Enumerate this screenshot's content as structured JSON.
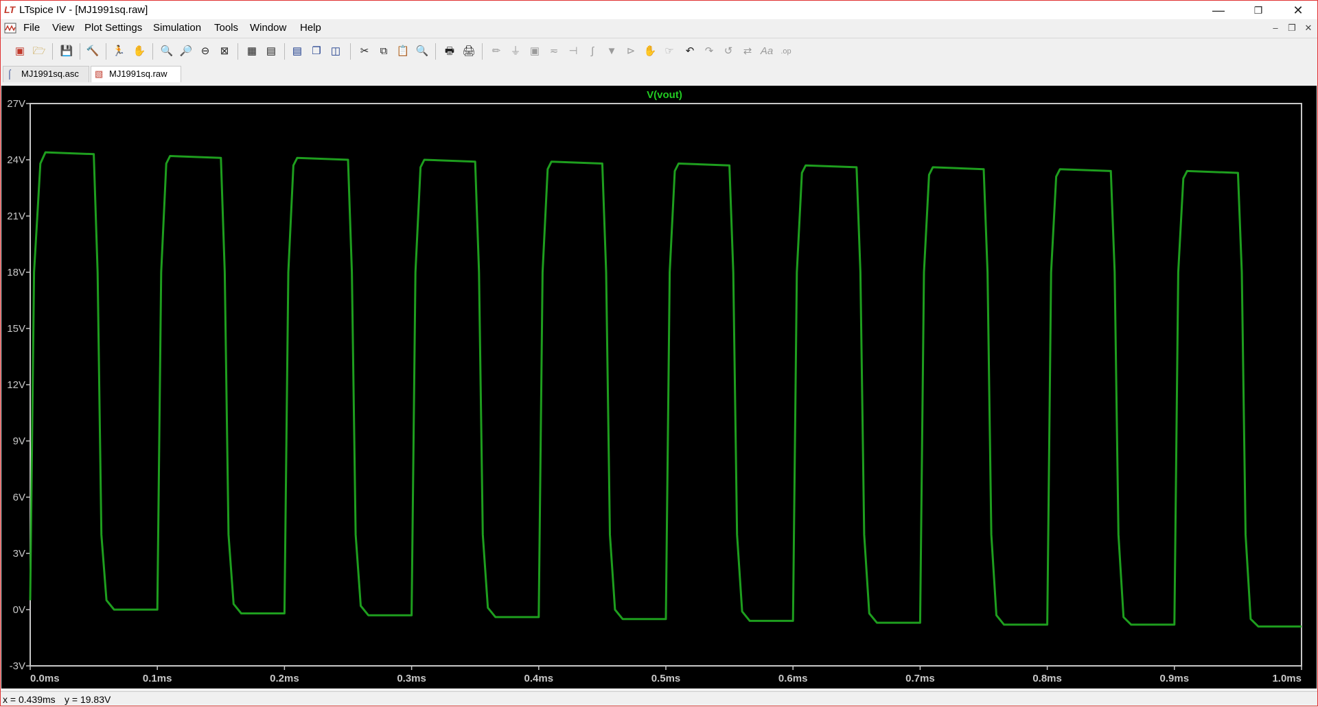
{
  "window": {
    "title": "LTspice IV - [MJ1991sq.raw]",
    "logo": "LT",
    "controls": [
      "minimize-icon",
      "restore-icon",
      "close-icon"
    ]
  },
  "menu": {
    "items": [
      "File",
      "View",
      "Plot Settings",
      "Simulation",
      "Tools",
      "Window",
      "Help"
    ]
  },
  "tabs": [
    {
      "label": "MJ1991sq.asc",
      "icon": "schematic-icon",
      "active": false
    },
    {
      "label": "MJ1991sq.raw",
      "icon": "waveform-icon",
      "active": true
    }
  ],
  "status": {
    "x_readout": "x = 0.439ms",
    "y_readout": "y = 19.83V"
  },
  "colors": {
    "trace": "#1e9e1e",
    "background": "#000000",
    "frame": "#c8c8c8",
    "title": "#22cc22"
  },
  "chart_data": {
    "type": "line",
    "title": "V(vout)",
    "xlabel": "",
    "ylabel": "",
    "xlim": [
      0,
      1.0
    ],
    "ylim": [
      -3,
      27
    ],
    "x_ticks": [
      "0.0ms",
      "0.1ms",
      "0.2ms",
      "0.3ms",
      "0.4ms",
      "0.5ms",
      "0.6ms",
      "0.7ms",
      "0.8ms",
      "0.9ms",
      "1.0ms"
    ],
    "y_ticks": [
      "27V",
      "24V",
      "21V",
      "18V",
      "15V",
      "12V",
      "9V",
      "6V",
      "3V",
      "0V",
      "-3V"
    ],
    "x_tick_values": [
      0,
      0.1,
      0.2,
      0.3,
      0.4,
      0.5,
      0.6,
      0.7,
      0.8,
      0.9,
      1.0
    ],
    "y_tick_values": [
      27,
      24,
      21,
      18,
      15,
      12,
      9,
      6,
      3,
      0,
      -3
    ],
    "grid": false,
    "series": [
      {
        "name": "V(vout)",
        "x": [
          0.0,
          0.003,
          0.008,
          0.012,
          0.05,
          0.053,
          0.056,
          0.06,
          0.066,
          0.1,
          0.103,
          0.107,
          0.11,
          0.15,
          0.153,
          0.156,
          0.16,
          0.166,
          0.2,
          0.203,
          0.207,
          0.21,
          0.25,
          0.253,
          0.256,
          0.26,
          0.266,
          0.3,
          0.303,
          0.307,
          0.31,
          0.35,
          0.353,
          0.356,
          0.36,
          0.366,
          0.4,
          0.403,
          0.407,
          0.41,
          0.45,
          0.453,
          0.456,
          0.46,
          0.466,
          0.5,
          0.503,
          0.507,
          0.51,
          0.55,
          0.553,
          0.556,
          0.56,
          0.566,
          0.6,
          0.603,
          0.607,
          0.61,
          0.65,
          0.653,
          0.656,
          0.66,
          0.666,
          0.7,
          0.703,
          0.707,
          0.71,
          0.75,
          0.753,
          0.756,
          0.76,
          0.766,
          0.8,
          0.803,
          0.807,
          0.81,
          0.85,
          0.853,
          0.856,
          0.86,
          0.866,
          0.9,
          0.903,
          0.907,
          0.91,
          0.95,
          0.953,
          0.956,
          0.96,
          0.966,
          1.0
        ],
        "y": [
          0.5,
          18.0,
          23.8,
          24.4,
          24.3,
          18.0,
          4.0,
          0.5,
          0.0,
          0.0,
          18.0,
          23.8,
          24.2,
          24.1,
          18.0,
          4.0,
          0.3,
          -0.2,
          -0.2,
          18.0,
          23.7,
          24.1,
          24.0,
          18.0,
          4.0,
          0.2,
          -0.3,
          -0.3,
          18.0,
          23.6,
          24.0,
          23.9,
          18.0,
          4.0,
          0.1,
          -0.4,
          -0.4,
          18.0,
          23.5,
          23.9,
          23.8,
          18.0,
          4.0,
          0.0,
          -0.5,
          -0.5,
          18.0,
          23.4,
          23.8,
          23.7,
          18.0,
          4.0,
          -0.1,
          -0.6,
          -0.6,
          18.0,
          23.3,
          23.7,
          23.6,
          18.0,
          4.0,
          -0.2,
          -0.7,
          -0.7,
          18.0,
          23.2,
          23.6,
          23.5,
          18.0,
          4.0,
          -0.3,
          -0.8,
          -0.8,
          18.0,
          23.1,
          23.5,
          23.4,
          18.0,
          4.0,
          -0.4,
          -0.8,
          -0.8,
          18.0,
          23.0,
          23.4,
          23.3,
          18.0,
          4.0,
          -0.5,
          -0.9,
          -0.9
        ]
      }
    ]
  }
}
